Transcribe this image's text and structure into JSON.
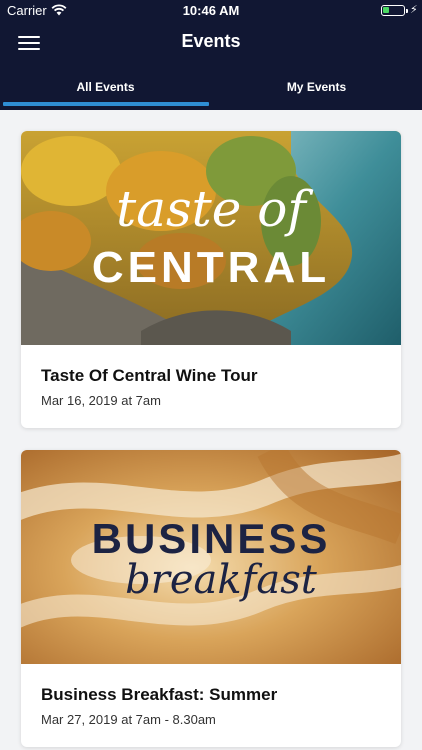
{
  "status_bar": {
    "carrier": "Carrier",
    "time": "10:46 AM",
    "battery_level": 0.35,
    "battery_color": "#4cd964"
  },
  "header": {
    "title": "Events",
    "menu_icon": "hamburger-menu-icon",
    "background": "#111733"
  },
  "tabs": [
    {
      "label": "All Events",
      "active": true
    },
    {
      "label": "My Events",
      "active": false
    }
  ],
  "accent_color": "#2f8fd5",
  "events": [
    {
      "title": "Taste Of Central Wine Tour",
      "date": "Mar 16, 2019 at 7am",
      "image": {
        "script_text": "taste of",
        "block_text": "CENTRAL"
      }
    },
    {
      "title": "Business Breakfast: Summer",
      "date": "Mar 27, 2019 at 7am - 8.30am",
      "image": {
        "block_text": "BUSINESS",
        "script_text": "breakfast"
      }
    }
  ]
}
